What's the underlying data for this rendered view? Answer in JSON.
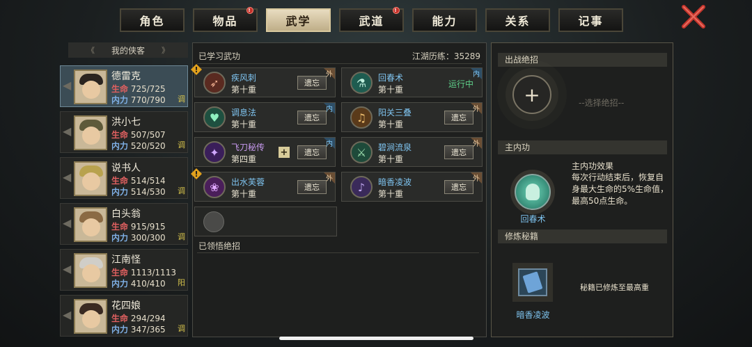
{
  "tabs": [
    {
      "label": "角色",
      "active": false,
      "alert": false
    },
    {
      "label": "物品",
      "active": false,
      "alert": true
    },
    {
      "label": "武学",
      "active": true,
      "alert": false
    },
    {
      "label": "武道",
      "active": false,
      "alert": true
    },
    {
      "label": "能力",
      "active": false,
      "alert": false
    },
    {
      "label": "关系",
      "active": false,
      "alert": false
    },
    {
      "label": "记事",
      "active": false,
      "alert": false
    }
  ],
  "alert_mark": "!",
  "roster": {
    "title": "我的侠客",
    "heroes": [
      {
        "name": "德雷克",
        "hp_label": "生命",
        "hp": "725/725",
        "mp_label": "内力",
        "mp": "770/790",
        "tag": "调",
        "selected": true
      },
      {
        "name": "洪小七",
        "hp_label": "生命",
        "hp": "507/507",
        "mp_label": "内力",
        "mp": "520/520",
        "tag": "调",
        "selected": false
      },
      {
        "name": "说书人",
        "hp_label": "生命",
        "hp": "514/514",
        "mp_label": "内力",
        "mp": "514/530",
        "tag": "调",
        "selected": false
      },
      {
        "name": "白头翁",
        "hp_label": "生命",
        "hp": "915/915",
        "mp_label": "内力",
        "mp": "300/300",
        "tag": "调",
        "selected": false
      },
      {
        "name": "江南怪",
        "hp_label": "生命",
        "hp": "1113/1113",
        "mp_label": "内力",
        "mp": "410/410",
        "tag": "阳",
        "selected": false
      },
      {
        "name": "花四娘",
        "hp_label": "生命",
        "hp": "294/294",
        "mp_label": "内力",
        "mp": "347/365",
        "tag": "调",
        "selected": false
      }
    ]
  },
  "learned": {
    "title": "已学习武功",
    "experience": "江湖历练：35289",
    "skills": [
      {
        "name": "疾风刺",
        "level": "第十重",
        "action": "遗忘",
        "badge": "外",
        "warn": true
      },
      {
        "name": "回春术",
        "level": "第十重",
        "action": "运行中",
        "badge": "内",
        "warn": false
      },
      {
        "name": "调息法",
        "level": "第十重",
        "action": "遗忘",
        "badge": "内",
        "warn": false
      },
      {
        "name": "阳关三叠",
        "level": "第十重",
        "action": "遗忘",
        "badge": "外",
        "warn": false
      },
      {
        "name": "飞刀秘传",
        "level": "第四重",
        "action": "遗忘",
        "badge": "内",
        "warn": false
      },
      {
        "name": "碧涧流泉",
        "level": "第十重",
        "action": "遗忘",
        "badge": "外",
        "warn": false
      },
      {
        "name": "出水芙蓉",
        "level": "第十重",
        "action": "遗忘",
        "badge": "外",
        "warn": true
      },
      {
        "name": "暗香凌波",
        "level": "第十重",
        "action": "遗忘",
        "badge": "外",
        "warn": false
      }
    ],
    "plus_mark": "+",
    "comprehended_title": "已领悟绝招"
  },
  "right_panel": {
    "ultimate_title": "出战绝招",
    "ultimate_plus": "+",
    "choose_text": "--选择绝招--",
    "internal_title": "主内功",
    "internal_name": "回春术",
    "effect_title": "主内功效果",
    "effect_text": "每次行动结束后，恢复自身最大生命的5%生命值，最高50点生命。",
    "manual_title": "修炼秘籍",
    "manual_name": "暗香凌波",
    "manual_status": "秘籍已修炼至最高重"
  },
  "colors": {
    "accent_blue": "#7fc4f0",
    "hp_red": "#e06060",
    "running_green": "#5fd08a",
    "warn": "#e3a21d"
  }
}
